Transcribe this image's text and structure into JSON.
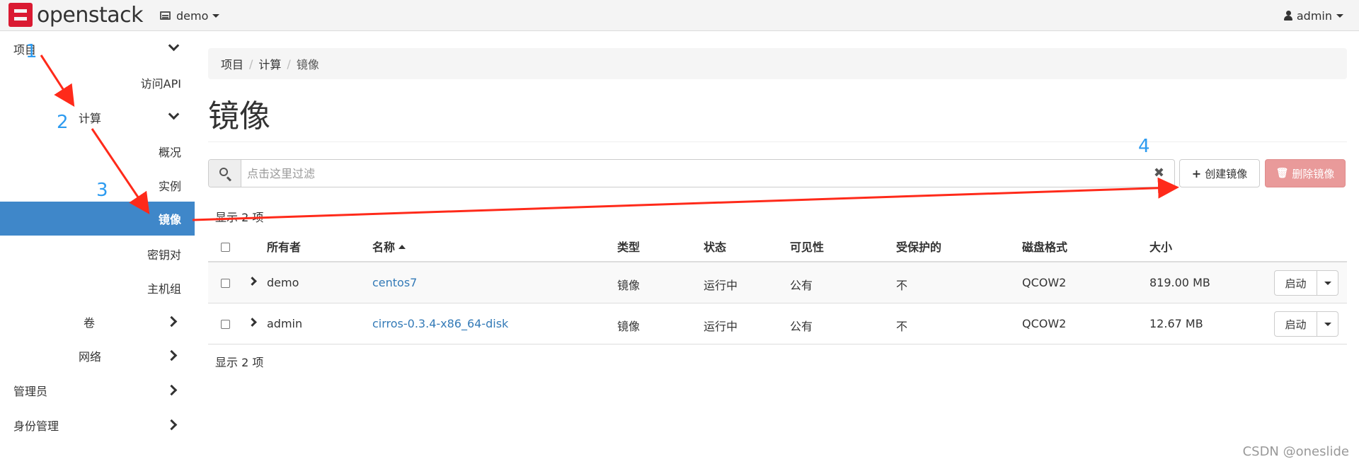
{
  "navbar": {
    "logo_text": "openstack",
    "project": "demo",
    "user": "admin"
  },
  "sidebar": {
    "items": [
      {
        "label": "项目"
      },
      {
        "label": "访问API"
      },
      {
        "label": "计算"
      },
      {
        "label": "概况"
      },
      {
        "label": "实例"
      },
      {
        "label": "镜像"
      },
      {
        "label": "密钥对"
      },
      {
        "label": "主机组"
      },
      {
        "label": "卷"
      },
      {
        "label": "网络"
      },
      {
        "label": "管理员"
      },
      {
        "label": "身份管理"
      }
    ]
  },
  "breadcrumb": [
    "项目",
    "计算",
    "镜像"
  ],
  "page_title": "镜像",
  "filter": {
    "placeholder": "点击这里过滤",
    "clear": "✖"
  },
  "actions": {
    "create": "创建镜像",
    "delete": "删除镜像"
  },
  "count_text": "显示 2 项",
  "table": {
    "headers": [
      "所有者",
      "名称",
      "类型",
      "状态",
      "可见性",
      "受保护的",
      "磁盘格式",
      "大小"
    ],
    "rows": [
      {
        "owner": "demo",
        "name": "centos7",
        "type": "镜像",
        "status": "运行中",
        "visibility": "公有",
        "protected": "不",
        "format": "QCOW2",
        "size": "819.00 MB",
        "action": "启动"
      },
      {
        "owner": "admin",
        "name": "cirros-0.3.4-x86_64-disk",
        "type": "镜像",
        "status": "运行中",
        "visibility": "公有",
        "protected": "不",
        "format": "QCOW2",
        "size": "12.67 MB",
        "action": "启动"
      }
    ]
  },
  "annotations": [
    "1",
    "2",
    "3",
    "4"
  ],
  "watermark": "CSDN @oneslide",
  "colors": {
    "active": "#3f87c9",
    "link": "#337ab7",
    "danger": "#e99a9a",
    "brand": "#da1a32",
    "annotation": "#2d9bf0",
    "arrow": "#ff2a1a"
  }
}
